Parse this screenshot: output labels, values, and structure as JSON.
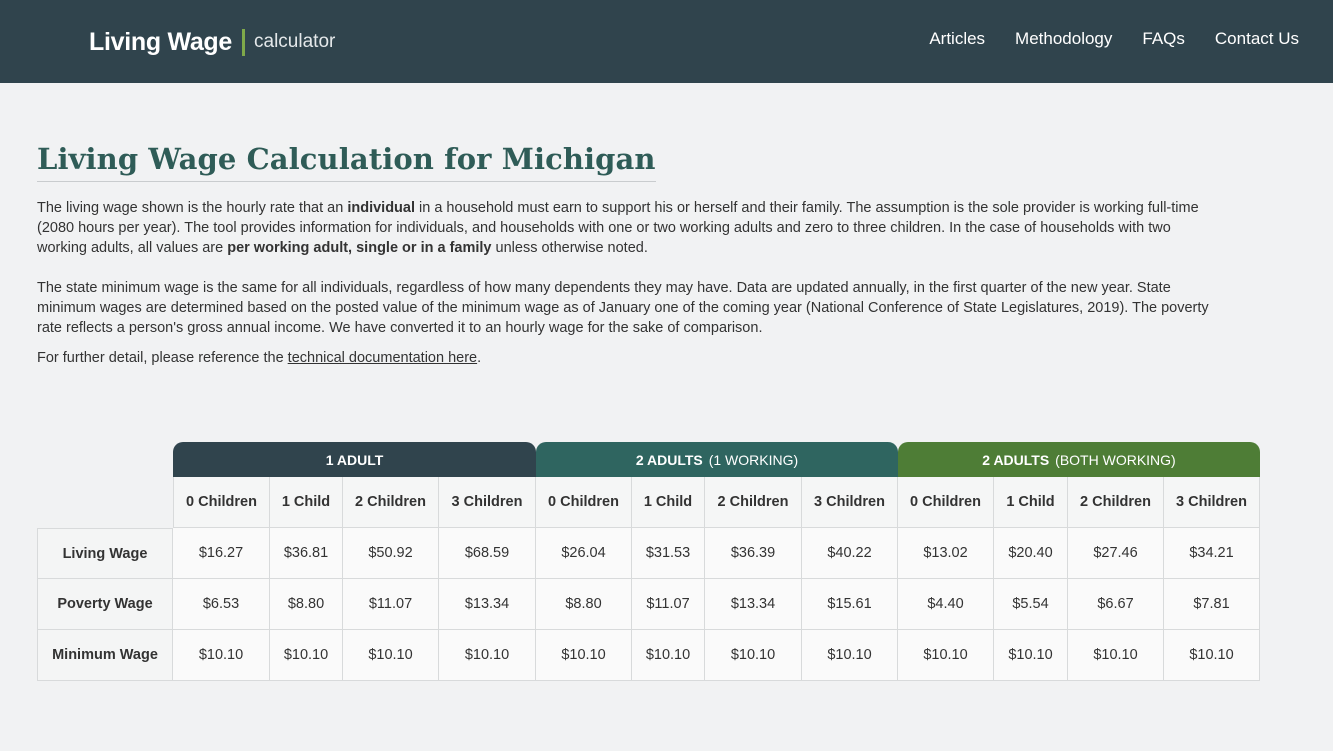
{
  "header": {
    "logo_main": "Living Wage",
    "logo_sub": "calculator",
    "nav": [
      "Articles",
      "Methodology",
      "FAQs",
      "Contact Us"
    ]
  },
  "title": "Living Wage Calculation for Michigan",
  "intro": {
    "p1_a": "The living wage shown is the hourly rate that an ",
    "p1_b": "individual",
    "p1_c": " in a household must earn to support his or herself and their family. The assumption is the sole provider is working full-time (2080 hours per year). The tool provides information for individuals, and households with one or two working adults and zero to three children. In the case of households with two working adults, all values are ",
    "p1_d": "per working adult, single or in a family",
    "p1_e": " unless otherwise noted.",
    "p2": "The state minimum wage is the same for all individuals, regardless of how many dependents they may have. Data are updated annually, in the first quarter of the new year. State minimum wages are determined based on the posted value of the minimum wage as of January one of the coming year (National Conference of State Legislatures, 2019). The poverty rate reflects a person's gross annual income. We have converted it to an hourly wage for the sake of comparison.",
    "p3_a": "For further detail, please reference the ",
    "p3_link": "technical documentation here",
    "p3_b": "."
  },
  "table": {
    "groups": [
      {
        "label": "1 ADULT",
        "sub": ""
      },
      {
        "label": "2 ADULTS",
        "sub": "(1 WORKING)"
      },
      {
        "label": "2 ADULTS",
        "sub": "(BOTH WORKING)"
      }
    ],
    "columns": [
      "0 Children",
      "1 Child",
      "2 Children",
      "3 Children",
      "0 Children",
      "1 Child",
      "2 Children",
      "3 Children",
      "0 Children",
      "1 Child",
      "2 Children",
      "3 Children"
    ],
    "rows": [
      {
        "label": "Living Wage",
        "values": [
          "$16.27",
          "$36.81",
          "$50.92",
          "$68.59",
          "$26.04",
          "$31.53",
          "$36.39",
          "$40.22",
          "$13.02",
          "$20.40",
          "$27.46",
          "$34.21"
        ]
      },
      {
        "label": "Poverty Wage",
        "values": [
          "$6.53",
          "$8.80",
          "$11.07",
          "$13.34",
          "$8.80",
          "$11.07",
          "$13.34",
          "$15.61",
          "$4.40",
          "$5.54",
          "$6.67",
          "$7.81"
        ]
      },
      {
        "label": "Minimum Wage",
        "values": [
          "$10.10",
          "$10.10",
          "$10.10",
          "$10.10",
          "$10.10",
          "$10.10",
          "$10.10",
          "$10.10",
          "$10.10",
          "$10.10",
          "$10.10",
          "$10.10"
        ]
      }
    ]
  }
}
